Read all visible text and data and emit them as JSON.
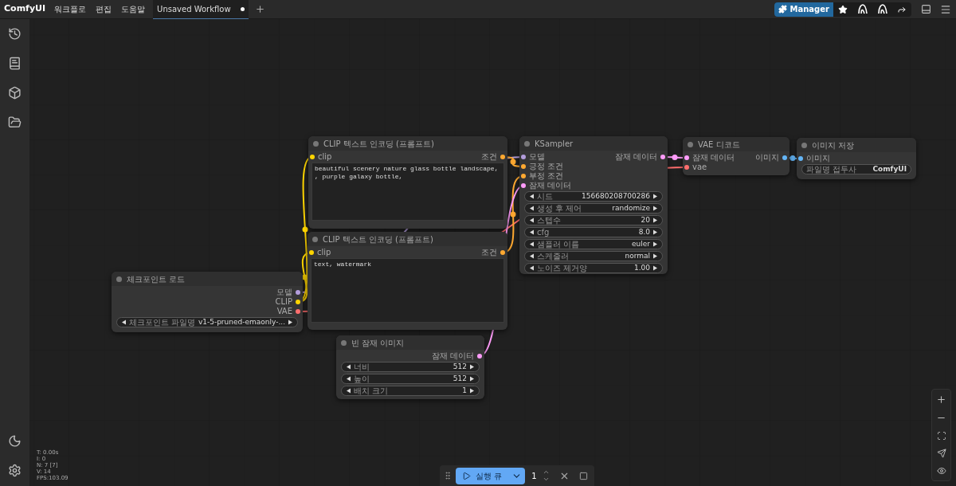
{
  "menu": {
    "brand": "ComfyUI",
    "items": [
      "워크플로",
      "편집",
      "도움말"
    ]
  },
  "tabs": [
    {
      "label": "Unsaved Workflow",
      "selected": true,
      "modified": true
    }
  ],
  "toolbar": {
    "manager": "Manager"
  },
  "nodes": [
    {
      "title": "체크포인트 로드",
      "outputs": [
        {
          "label": "모델",
          "color": "#b39ddb"
        },
        {
          "label": "CLIP",
          "color": "#ffd500"
        },
        {
          "label": "VAE",
          "color": "#ff6e6e"
        }
      ],
      "widgets": [
        {
          "kind": "combo",
          "label": "체크포인트 파일명",
          "value": "v1-5-pruned-emaonly-..."
        }
      ]
    },
    {
      "title": "CLIP 텍스트 인코딩 (프롬프트)",
      "inputs": [
        {
          "label": "clip",
          "color": "#ffd500"
        }
      ],
      "outputs": [
        {
          "label": "조건",
          "color": "#ffa931"
        }
      ],
      "text": "beautiful scenery nature glass bottle landscape, , purple galaxy bottle,"
    },
    {
      "title": "CLIP 텍스트 인코딩 (프롬프트)",
      "inputs": [
        {
          "label": "clip",
          "color": "#ffd500"
        }
      ],
      "outputs": [
        {
          "label": "조건",
          "color": "#ffa931"
        }
      ],
      "text": "text, watermark"
    },
    {
      "title": "KSampler",
      "inputs": [
        {
          "label": "모델",
          "color": "#b39ddb"
        },
        {
          "label": "긍정 조건",
          "color": "#ffa931"
        },
        {
          "label": "부정 조건",
          "color": "#ffa931"
        },
        {
          "label": "잠재 데이터",
          "color": "#ff9cf9"
        }
      ],
      "outputs": [
        {
          "label": "잠재 데이터",
          "color": "#ff9cf9"
        }
      ],
      "widgets": [
        {
          "kind": "number",
          "label": "시드",
          "value": "156680208700286"
        },
        {
          "kind": "combo",
          "label": "생성 후 제어",
          "value": "randomize"
        },
        {
          "kind": "number",
          "label": "스텝수",
          "value": "20"
        },
        {
          "kind": "number",
          "label": "cfg",
          "value": "8.0"
        },
        {
          "kind": "combo",
          "label": "샘플러 이름",
          "value": "euler"
        },
        {
          "kind": "combo",
          "label": "스케줄러",
          "value": "normal"
        },
        {
          "kind": "number",
          "label": "노이즈 제거양",
          "value": "1.00"
        }
      ]
    },
    {
      "title": "빈 잠재 이미지",
      "outputs": [
        {
          "label": "잠재 데이터",
          "color": "#ff9cf9"
        }
      ],
      "widgets": [
        {
          "kind": "number",
          "label": "너비",
          "value": "512"
        },
        {
          "kind": "number",
          "label": "높이",
          "value": "512"
        },
        {
          "kind": "number",
          "label": "배치 크기",
          "value": "1"
        }
      ]
    },
    {
      "title": "VAE 디코드",
      "inputs": [
        {
          "label": "잠재 데이터",
          "color": "#ff9cf9"
        },
        {
          "label": "vae",
          "color": "#ff6e6e"
        }
      ],
      "outputs": [
        {
          "label": "이미지",
          "color": "#64b5f6"
        }
      ]
    },
    {
      "title": "이미지 저장",
      "inputs": [
        {
          "label": "이미지",
          "color": "#64b5f6"
        }
      ],
      "widgets": [
        {
          "kind": "text",
          "label": "파일명 접두사",
          "value": "ComfyUI"
        }
      ]
    }
  ],
  "stats": [
    "T: 0.00s",
    "I: 0",
    "N: 7 [7]",
    "V: 14",
    "FPS:103.09"
  ],
  "queue": {
    "run": "실행 큐",
    "count": "1"
  }
}
